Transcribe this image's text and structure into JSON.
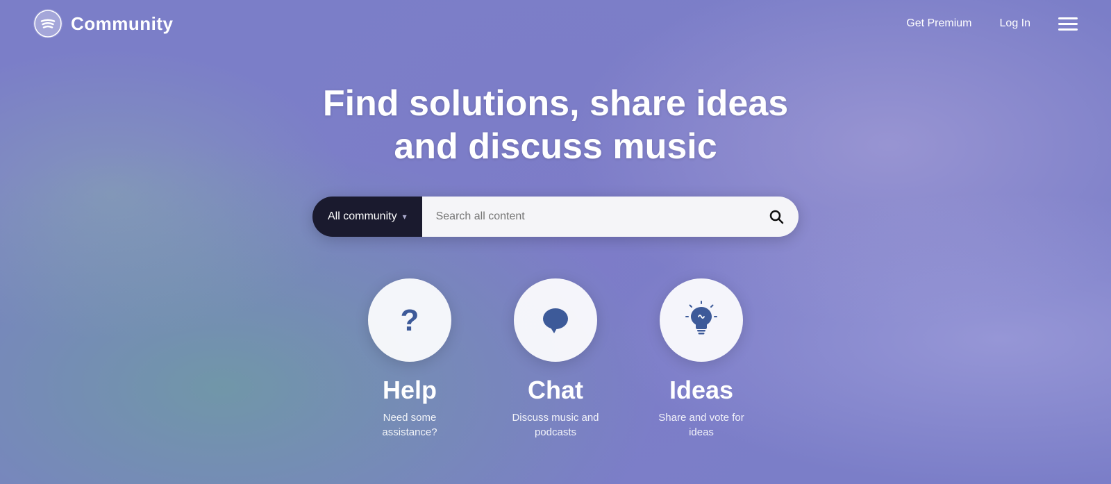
{
  "nav": {
    "title": "Community",
    "get_premium": "Get Premium",
    "log_in": "Log In"
  },
  "hero": {
    "heading": "Find solutions, share ideas\nand discuss music"
  },
  "search": {
    "dropdown_label": "All community",
    "placeholder": "Search all content"
  },
  "cards": [
    {
      "id": "help",
      "title": "Help",
      "subtitle": "Need some assistance?",
      "icon": "help"
    },
    {
      "id": "chat",
      "title": "Chat",
      "subtitle": "Discuss music and podcasts",
      "icon": "chat"
    },
    {
      "id": "ideas",
      "title": "Ideas",
      "subtitle": "Share and vote for ideas",
      "icon": "ideas"
    }
  ],
  "colors": {
    "icon_blue": "#3d5a99",
    "icon_circle_bg": "rgba(255,255,255,0.92)"
  }
}
